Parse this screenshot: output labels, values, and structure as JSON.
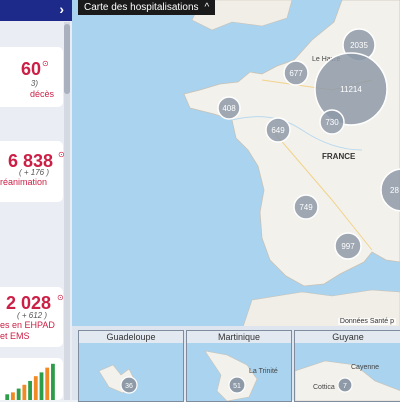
{
  "sidebar": {
    "header_chevron": "›",
    "card1": {
      "value": "60",
      "delta": "3)",
      "label": "décès"
    },
    "card2": {
      "value": "6 838",
      "delta": "( + 176 )",
      "label": "réanimation"
    },
    "card3": {
      "value": "2 028",
      "delta": "( + 612 )",
      "label_line1": "es en EHPAD",
      "label_line2": "et EMS"
    }
  },
  "map": {
    "title": "Carte des hospitalisations",
    "title_arrow": "^",
    "country_label": "FRANCE",
    "city_label": "Le Havre",
    "attribution": "Données Santé p",
    "clusters": [
      {
        "value": "2035"
      },
      {
        "value": "677"
      },
      {
        "value": "11214"
      },
      {
        "value": "408"
      },
      {
        "value": "649"
      },
      {
        "value": "730"
      },
      {
        "value": "749"
      },
      {
        "value": "997"
      },
      {
        "value": "28"
      }
    ]
  },
  "insets": [
    {
      "title": "Guadeloupe",
      "cluster": "36"
    },
    {
      "title": "Martinique",
      "cluster": "51",
      "place": "La Trinité"
    },
    {
      "title": "Guyane",
      "cluster": "7",
      "place1": "Cayenne",
      "place2": "Cottica"
    }
  ]
}
